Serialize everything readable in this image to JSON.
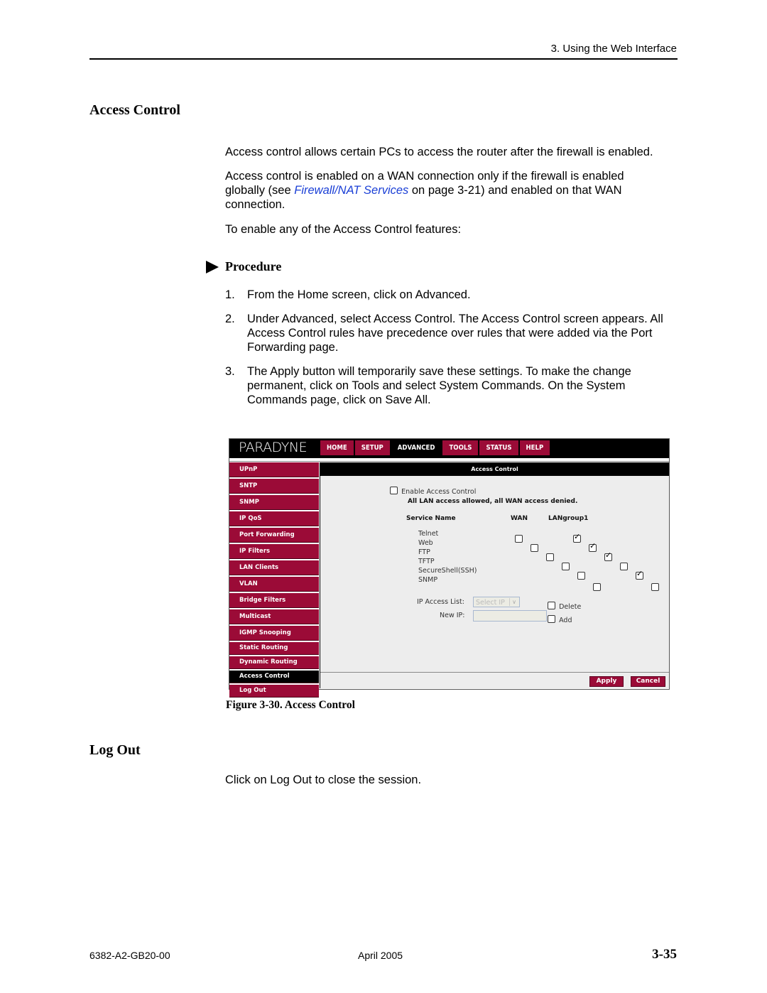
{
  "header": {
    "running_head": "3. Using the Web Interface"
  },
  "section1": {
    "title": "Access Control",
    "paragraphs": [
      "Access control allows certain PCs to access the router after the firewall is enabled.",
      "Access control is enabled on a WAN connection only if the firewall is enabled globally (see ",
      "To enable any of the Access Control features:"
    ],
    "link_text": "Firewall/NAT Services",
    "para2_tail": " on page 3-21) and enabled on that WAN connection.",
    "procedure_label": "Procedure",
    "steps": [
      {
        "num": "1.",
        "text": "From the Home screen, click on Advanced."
      },
      {
        "num": "2.",
        "text": "Under Advanced, select Access Control. The Access Control screen appears. All Access Control rules have precedence over rules that were added via the Port Forwarding page."
      },
      {
        "num": "3.",
        "text": "The Apply button will temporarily save these settings. To make the change permanent, click on Tools and select System Commands. On the System Commands page, click on Save All."
      }
    ]
  },
  "figure": {
    "caption": "Figure 3-30.   Access Control",
    "screen": {
      "logo": "PARADYNE",
      "nav": [
        "HOME",
        "SETUP",
        "ADVANCED",
        "TOOLS",
        "STATUS",
        "HELP"
      ],
      "nav_active": "ADVANCED",
      "sidebar": [
        "UPnP",
        "SNTP",
        "SNMP",
        "IP QoS",
        "Port Forwarding",
        "IP Filters",
        "LAN Clients",
        "VLAN",
        "Bridge Filters",
        "Multicast",
        "IGMP Snooping",
        "Static Routing",
        "Dynamic Routing",
        "Access Control",
        "Log Out"
      ],
      "sidebar_active": "Access Control",
      "panel_title": "Access Control",
      "enable_label": "Enable Access Control",
      "enable_checked": false,
      "status_msg": "All LAN access allowed, all WAN access denied.",
      "columns": [
        "Service Name",
        "WAN",
        "LANgroup1"
      ],
      "services": [
        {
          "name": "Telnet",
          "wan": false,
          "lan": true
        },
        {
          "name": "Web",
          "wan": false,
          "lan": true
        },
        {
          "name": "FTP",
          "wan": false,
          "lan": true
        },
        {
          "name": "TFTP",
          "wan": false,
          "lan": false
        },
        {
          "name": "SecureShell(SSH)",
          "wan": false,
          "lan": true
        },
        {
          "name": "SNMP",
          "wan": false,
          "lan": false
        }
      ],
      "ip_access_list_label": "IP Access List:",
      "ip_access_list_value": "Select IP",
      "delete_label": "Delete",
      "new_ip_label": "New IP:",
      "new_ip_value": "",
      "add_label": "Add",
      "apply_label": "Apply",
      "cancel_label": "Cancel",
      "colors": {
        "accent": "#9b0b37",
        "bar": "#000000",
        "panel": "#ededed"
      }
    }
  },
  "section2": {
    "title": "Log Out",
    "text": "Click on Log Out to close the session."
  },
  "footer": {
    "doc_number": "6382-A2-GB20-00",
    "date": "April 2005",
    "page": "3-35"
  }
}
